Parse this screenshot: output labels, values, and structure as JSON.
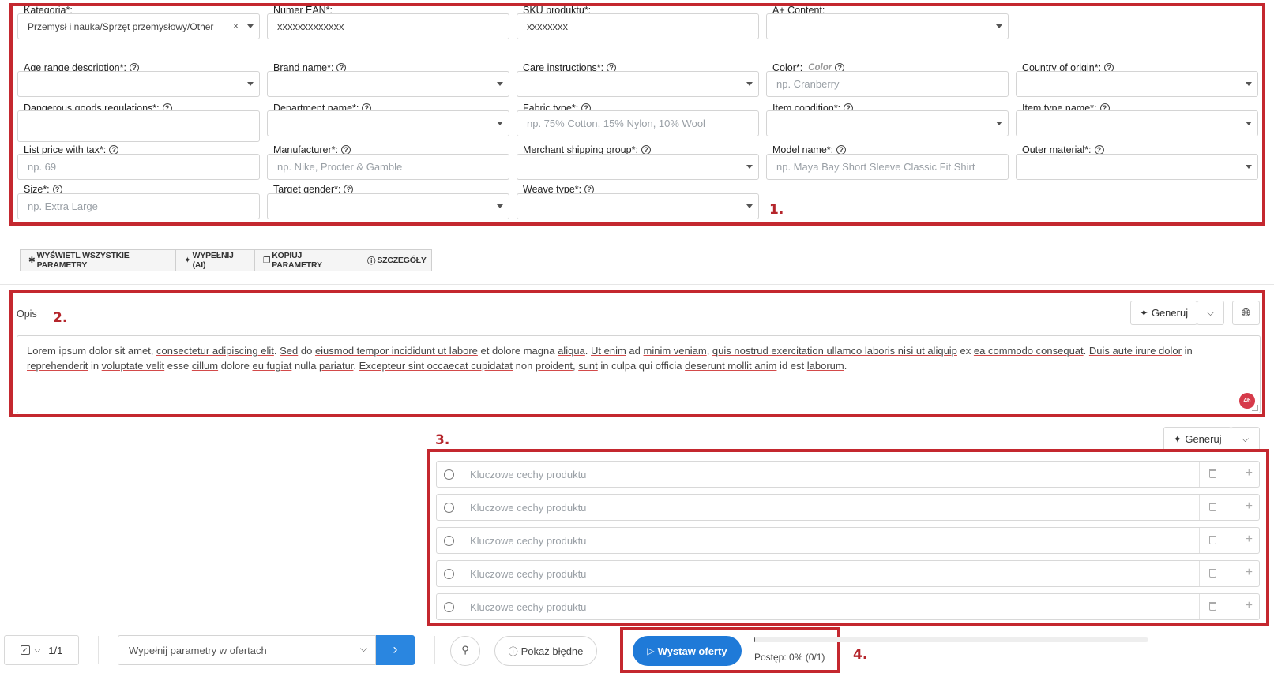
{
  "section1": {
    "marker": "1.",
    "top_fields": [
      {
        "label": "Kategoria*:",
        "value": "Przemysł i nauka/Sprzęt przemysłowy/Other",
        "clearable": true,
        "dropdown": true
      },
      {
        "label": "Numer EAN*:",
        "value": "xxxxxxxxxxxxx",
        "dropdown": false
      },
      {
        "label": "SKU produktu*:",
        "value": "xxxxxxxx",
        "dropdown": false
      },
      {
        "label": "A+ Content:",
        "value": "",
        "dropdown": true
      }
    ],
    "fields": [
      {
        "label": "Age range description*:",
        "placeholder": "",
        "dropdown": true
      },
      {
        "label": "Brand name*:",
        "placeholder": "",
        "dropdown": true
      },
      {
        "label": "Care instructions*:",
        "placeholder": "",
        "dropdown": true
      },
      {
        "label": "Color*:",
        "sub": "Color",
        "placeholder": "np. Cranberry",
        "dropdown": false
      },
      {
        "label": "Country of origin*:",
        "placeholder": "",
        "dropdown": true
      },
      {
        "label": "Dangerous goods regulations*:",
        "placeholder": "",
        "dropdown": false
      },
      {
        "label": "Department name*:",
        "placeholder": "",
        "dropdown": true
      },
      {
        "label": "Fabric type*:",
        "placeholder": "np. 75% Cotton, 15% Nylon, 10% Wool",
        "dropdown": false
      },
      {
        "label": "Item condition*:",
        "placeholder": "",
        "dropdown": true
      },
      {
        "label": "Item type name*:",
        "placeholder": "",
        "dropdown": true
      },
      {
        "label": "List price with tax*:",
        "placeholder": "np. 69",
        "dropdown": false
      },
      {
        "label": "Manufacturer*:",
        "placeholder": "np. Nike, Procter & Gamble",
        "dropdown": false
      },
      {
        "label": "Merchant shipping group*:",
        "placeholder": "",
        "dropdown": true
      },
      {
        "label": "Model name*:",
        "placeholder": "np. Maya Bay Short Sleeve Classic Fit Shirt",
        "dropdown": false
      },
      {
        "label": "Outer material*:",
        "placeholder": "",
        "dropdown": true
      },
      {
        "label": "Size*:",
        "placeholder": "np. Extra Large",
        "dropdown": false
      },
      {
        "label": "Target gender*:",
        "placeholder": "",
        "dropdown": true
      },
      {
        "label": "Weave type*:",
        "placeholder": "",
        "dropdown": true
      }
    ]
  },
  "toolbar": {
    "show_all": "WYŚWIETL WSZYSTKIE PARAMETRY",
    "fill_ai": "WYPEŁNIJ (AI)",
    "copy_params": "KOPIUJ PARAMETRY",
    "details": "SZCZEGÓŁY"
  },
  "description": {
    "label": "Opis",
    "marker": "2.",
    "generate_label": "Generuj",
    "char_badge": "46",
    "segments": [
      {
        "t": "Lorem ipsum dolor sit amet, "
      },
      {
        "t": "consectetur adipiscing elit",
        "u": true
      },
      {
        "t": ". "
      },
      {
        "t": "Sed",
        "u": true
      },
      {
        "t": " do "
      },
      {
        "t": "eiusmod tempor incididunt ut labore",
        "u": true
      },
      {
        "t": " et dolore magna "
      },
      {
        "t": "aliqua",
        "u": true
      },
      {
        "t": ". "
      },
      {
        "t": "Ut enim",
        "u": true
      },
      {
        "t": " ad "
      },
      {
        "t": "minim veniam",
        "u": true
      },
      {
        "t": ", "
      },
      {
        "t": "quis nostrud exercitation ullamco laboris nisi ut aliquip",
        "u": true
      },
      {
        "t": " ex "
      },
      {
        "t": "ea commodo consequat",
        "u": true
      },
      {
        "t": ". "
      },
      {
        "t": "Duis aute irure dolor",
        "u": true
      },
      {
        "t": " in "
      },
      {
        "t": "reprehenderit",
        "u": true
      },
      {
        "t": " in "
      },
      {
        "t": "voluptate velit",
        "u": true
      },
      {
        "t": " esse "
      },
      {
        "t": "cillum",
        "u": true
      },
      {
        "t": " dolore "
      },
      {
        "t": "eu fugiat",
        "u": true
      },
      {
        "t": " nulla "
      },
      {
        "t": "pariatur",
        "u": true
      },
      {
        "t": ". "
      },
      {
        "t": "Excepteur sint occaecat cupidatat",
        "u": true
      },
      {
        "t": " non "
      },
      {
        "t": "proident",
        "u": true
      },
      {
        "t": ", "
      },
      {
        "t": "sunt",
        "u": true
      },
      {
        "t": " in culpa qui officia "
      },
      {
        "t": "deserunt mollit anim",
        "u": true
      },
      {
        "t": " id est "
      },
      {
        "t": "laborum",
        "u": true
      },
      {
        "t": "."
      }
    ]
  },
  "features": {
    "marker": "3.",
    "generate_label": "Generuj",
    "placeholder": "Kluczowe cechy produktu",
    "rows": 5
  },
  "bottom": {
    "page_counter": "1/1",
    "action_select": "Wypełnij parametry w ofertach",
    "show_errors": "Pokaż błędne",
    "publish_button": "Wystaw oferty",
    "progress_text": "Postęp: 0% (0/1)",
    "progress_fraction": 0.0,
    "marker": "4."
  },
  "colors": {
    "accent": "#1f7ad8",
    "highlight": "#c4282f",
    "badge": "#d63a4a"
  }
}
